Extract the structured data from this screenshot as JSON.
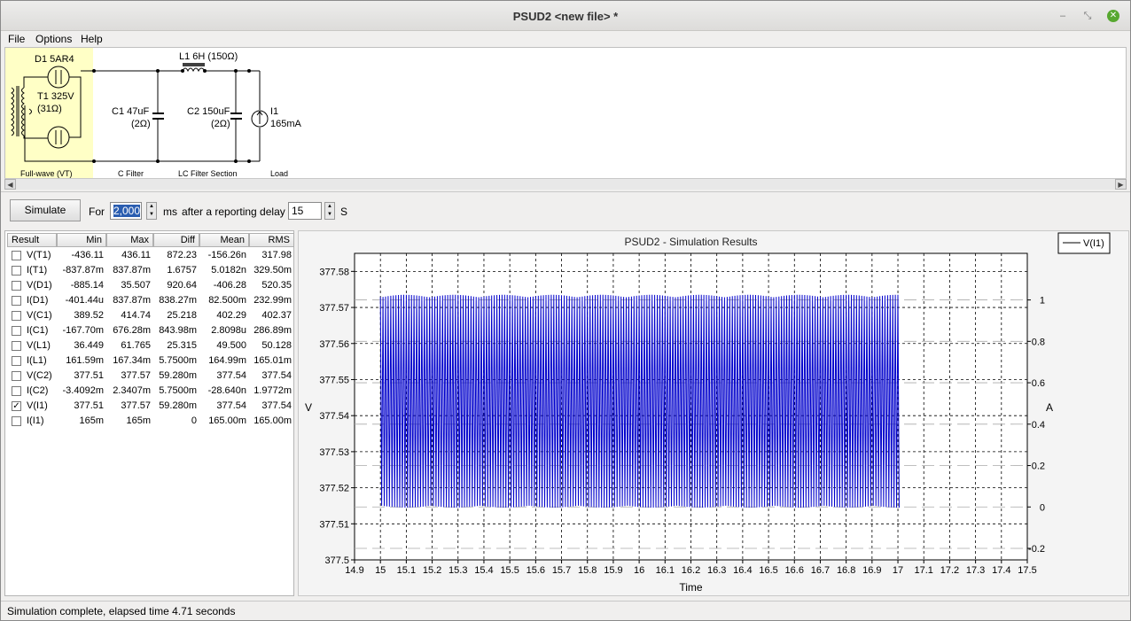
{
  "window": {
    "title": "PSUD2  <new file> *",
    "minimize": "‒",
    "maximize": "⤡",
    "close": "✕"
  },
  "menu": [
    {
      "label": "File"
    },
    {
      "label": "Options"
    },
    {
      "label": "Help"
    }
  ],
  "schematic": {
    "rectifier": {
      "tube": "D1 5AR4",
      "transformer": "T1 325V",
      "transformer_r": "(31Ω)",
      "section": "Full-wave (VT)"
    },
    "c_filter": {
      "cap": "C1 47uF",
      "cap_r": "(2Ω)",
      "section": "C Filter"
    },
    "lc_filter": {
      "inductor": "L1 6H (150Ω)",
      "cap": "C2 150uF",
      "cap_r": "(2Ω)",
      "section": "LC Filter Section"
    },
    "load": {
      "name": "I1",
      "value": "165mA",
      "section": "Load"
    }
  },
  "toolbar": {
    "simulate": "Simulate",
    "for_label": "For",
    "duration": "2,000",
    "ms_label": "ms",
    "delay_label": "after a reporting delay of",
    "delay": "15",
    "s_label": "S"
  },
  "table": {
    "headers": [
      "Result",
      "Min",
      "Max",
      "Diff",
      "Mean",
      "RMS"
    ],
    "rows": [
      {
        "name": "V(T1)",
        "checked": false,
        "min": "-436.11",
        "max": "436.11",
        "diff": "872.23",
        "mean": "-156.26n",
        "rms": "317.98"
      },
      {
        "name": "I(T1)",
        "checked": false,
        "min": "-837.87m",
        "max": "837.87m",
        "diff": "1.6757",
        "mean": "5.0182n",
        "rms": "329.50m"
      },
      {
        "name": "V(D1)",
        "checked": false,
        "min": "-885.14",
        "max": "35.507",
        "diff": "920.64",
        "mean": "-406.28",
        "rms": "520.35"
      },
      {
        "name": "I(D1)",
        "checked": false,
        "min": "-401.44u",
        "max": "837.87m",
        "diff": "838.27m",
        "mean": "82.500m",
        "rms": "232.99m"
      },
      {
        "name": "V(C1)",
        "checked": false,
        "min": "389.52",
        "max": "414.74",
        "diff": "25.218",
        "mean": "402.29",
        "rms": "402.37"
      },
      {
        "name": "I(C1)",
        "checked": false,
        "min": "-167.70m",
        "max": "676.28m",
        "diff": "843.98m",
        "mean": "2.8098u",
        "rms": "286.89m"
      },
      {
        "name": "V(L1)",
        "checked": false,
        "min": "36.449",
        "max": "61.765",
        "diff": "25.315",
        "mean": "49.500",
        "rms": "50.128"
      },
      {
        "name": "I(L1)",
        "checked": false,
        "min": "161.59m",
        "max": "167.34m",
        "diff": "5.7500m",
        "mean": "164.99m",
        "rms": "165.01m"
      },
      {
        "name": "V(C2)",
        "checked": false,
        "min": "377.51",
        "max": "377.57",
        "diff": "59.280m",
        "mean": "377.54",
        "rms": "377.54"
      },
      {
        "name": "I(C2)",
        "checked": false,
        "min": "-3.4092m",
        "max": "2.3407m",
        "diff": "5.7500m",
        "mean": "-28.640n",
        "rms": "1.9772m"
      },
      {
        "name": "V(I1)",
        "checked": true,
        "min": "377.51",
        "max": "377.57",
        "diff": "59.280m",
        "mean": "377.54",
        "rms": "377.54"
      },
      {
        "name": "I(I1)",
        "checked": false,
        "min": "165m",
        "max": "165m",
        "diff": "0",
        "mean": "165.00m",
        "rms": "165.00m"
      }
    ]
  },
  "chart_data": {
    "type": "line",
    "title": "PSUD2 - Simulation Results",
    "xlabel": "Time",
    "ylabel": "V",
    "y2label": "A",
    "xlim": [
      14.9,
      17.5
    ],
    "ylim": [
      377.5,
      377.585
    ],
    "y2lim": [
      -0.2556,
      1.225
    ],
    "xticks": [
      "14.9",
      "15",
      "15.1",
      "15.2",
      "15.3",
      "15.4",
      "15.5",
      "15.6",
      "15.7",
      "15.8",
      "15.9",
      "16",
      "16.1",
      "16.2",
      "16.3",
      "16.4",
      "16.5",
      "16.6",
      "16.7",
      "16.8",
      "16.9",
      "17",
      "17.1",
      "17.2",
      "17.3",
      "17.4",
      "17.5"
    ],
    "yticks": [
      "377.5",
      "377.51",
      "377.52",
      "377.53",
      "377.54",
      "377.55",
      "377.56",
      "377.57",
      "377.58"
    ],
    "y2ticks": [
      "-0.2",
      "0",
      "0.2",
      "0.4",
      "0.6",
      "0.8",
      "1"
    ],
    "grid": true,
    "legend_position": "right",
    "series": [
      {
        "name": "V(I1)",
        "color": "#0000cc",
        "x_start": 15,
        "x_end": 17,
        "period": 0.01,
        "min": 377.5145,
        "max": 377.5735,
        "mean": 377.54
      }
    ]
  },
  "status": "Simulation complete, elapsed time 4.71 seconds"
}
